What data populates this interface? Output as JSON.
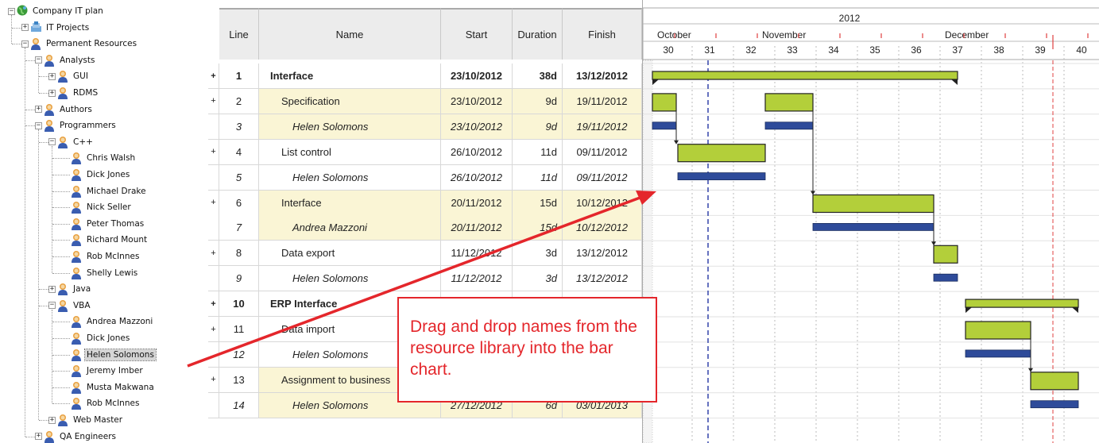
{
  "tree": {
    "nodes": [
      {
        "label": "Company IT plan",
        "level": 0,
        "type": "globe",
        "toggle": "−"
      },
      {
        "label": "IT Projects",
        "level": 1,
        "type": "projects",
        "toggle": "+"
      },
      {
        "label": "Permanent Resources",
        "level": 1,
        "type": "group",
        "toggle": "−"
      },
      {
        "label": "Analysts",
        "level": 2,
        "type": "group",
        "toggle": "−"
      },
      {
        "label": "GUI",
        "level": 3,
        "type": "group",
        "toggle": "+"
      },
      {
        "label": "RDMS",
        "level": 3,
        "type": "group",
        "toggle": "+"
      },
      {
        "label": "Authors",
        "level": 2,
        "type": "group",
        "toggle": "+"
      },
      {
        "label": "Programmers",
        "level": 2,
        "type": "group",
        "toggle": "−"
      },
      {
        "label": "C++",
        "level": 3,
        "type": "group",
        "toggle": "−"
      },
      {
        "label": "Chris Walsh",
        "level": 4,
        "type": "person"
      },
      {
        "label": "Dick Jones",
        "level": 4,
        "type": "person"
      },
      {
        "label": "Michael Drake",
        "level": 4,
        "type": "person"
      },
      {
        "label": "Nick Seller",
        "level": 4,
        "type": "person"
      },
      {
        "label": "Peter Thomas",
        "level": 4,
        "type": "person"
      },
      {
        "label": "Richard Mount",
        "level": 4,
        "type": "person"
      },
      {
        "label": "Rob McInnes",
        "level": 4,
        "type": "person"
      },
      {
        "label": "Shelly Lewis",
        "level": 4,
        "type": "person"
      },
      {
        "label": "Java",
        "level": 3,
        "type": "group",
        "toggle": "+"
      },
      {
        "label": "VBA",
        "level": 3,
        "type": "group",
        "toggle": "−"
      },
      {
        "label": "Andrea Mazzoni",
        "level": 4,
        "type": "person"
      },
      {
        "label": "Dick Jones",
        "level": 4,
        "type": "person"
      },
      {
        "label": "Helen Solomons",
        "level": 4,
        "type": "person",
        "selected": true
      },
      {
        "label": "Jeremy Imber",
        "level": 4,
        "type": "person"
      },
      {
        "label": "Musta Makwana",
        "level": 4,
        "type": "person"
      },
      {
        "label": "Rob McInnes",
        "level": 4,
        "type": "person"
      },
      {
        "label": "Web Master",
        "level": 3,
        "type": "group",
        "toggle": "+"
      },
      {
        "label": "QA Engineers",
        "level": 2,
        "type": "group",
        "toggle": "+"
      }
    ]
  },
  "grid": {
    "headers": {
      "line": "Line",
      "name": "Name",
      "start": "Start",
      "duration": "Duration",
      "finish": "Finish"
    },
    "rows": [
      {
        "line": "1",
        "name": "Interface",
        "start": "23/10/2012",
        "duration": "38d",
        "finish": "13/12/2012",
        "kind": "summary",
        "indent": 0,
        "expander": "+"
      },
      {
        "line": "2",
        "name": "Specification",
        "start": "23/10/2012",
        "duration": "9d",
        "finish": "19/11/2012",
        "kind": "task-y",
        "indent": 1,
        "expander": "+"
      },
      {
        "line": "3",
        "name": "Helen Solomons",
        "start": "23/10/2012",
        "duration": "9d",
        "finish": "19/11/2012",
        "kind": "res-y",
        "indent": 2,
        "expander": ""
      },
      {
        "line": "4",
        "name": "List control",
        "start": "26/10/2012",
        "duration": "11d",
        "finish": "09/11/2012",
        "kind": "task",
        "indent": 1,
        "expander": "+"
      },
      {
        "line": "5",
        "name": "Helen Solomons",
        "start": "26/10/2012",
        "duration": "11d",
        "finish": "09/11/2012",
        "kind": "res",
        "indent": 2,
        "expander": ""
      },
      {
        "line": "6",
        "name": "Interface",
        "start": "20/11/2012",
        "duration": "15d",
        "finish": "10/12/2012",
        "kind": "task-y",
        "indent": 1,
        "expander": "+"
      },
      {
        "line": "7",
        "name": "Andrea Mazzoni",
        "start": "20/11/2012",
        "duration": "15d",
        "finish": "10/12/2012",
        "kind": "res-y",
        "indent": 2,
        "expander": ""
      },
      {
        "line": "8",
        "name": "Data export",
        "start": "11/12/2012",
        "duration": "3d",
        "finish": "13/12/2012",
        "kind": "task",
        "indent": 1,
        "expander": "+"
      },
      {
        "line": "9",
        "name": "Helen Solomons",
        "start": "11/12/2012",
        "duration": "3d",
        "finish": "13/12/2012",
        "kind": "res",
        "indent": 2,
        "expander": ""
      },
      {
        "line": "10",
        "name": "ERP Interface",
        "start": "",
        "duration": "",
        "finish": "",
        "kind": "summary",
        "indent": 0,
        "expander": "+"
      },
      {
        "line": "11",
        "name": "Data import",
        "start": "",
        "duration": "",
        "finish": "",
        "kind": "task",
        "indent": 1,
        "expander": "+"
      },
      {
        "line": "12",
        "name": "Helen Solomons",
        "start": "",
        "duration": "",
        "finish": "",
        "kind": "res",
        "indent": 2,
        "expander": ""
      },
      {
        "line": "13",
        "name": "Assignment to business",
        "start": "",
        "duration": "",
        "finish": "",
        "kind": "task-y",
        "indent": 1,
        "expander": "+"
      },
      {
        "line": "14",
        "name": "Helen Solomons",
        "start": "27/12/2012",
        "duration": "6d",
        "finish": "03/01/2013",
        "kind": "res-y",
        "indent": 2,
        "expander": ""
      }
    ]
  },
  "gantt": {
    "year": "2012",
    "months": [
      "October",
      "November",
      "December"
    ],
    "weeks": [
      "30",
      "31",
      "32",
      "33",
      "34",
      "35",
      "36",
      "37",
      "38",
      "39",
      "40"
    ],
    "colors": {
      "task": "#b3cf3a",
      "resource": "#2e4b9a",
      "summary": "#b3cf3a",
      "today": "#3344aa",
      "deadline": "#e04040"
    }
  },
  "callout": {
    "text": "Drag and drop names from the resource library into the bar chart."
  },
  "colors": {
    "arrow": "#e4262b",
    "row_highlight": "#faf5d5",
    "header_bg": "#ececec"
  }
}
